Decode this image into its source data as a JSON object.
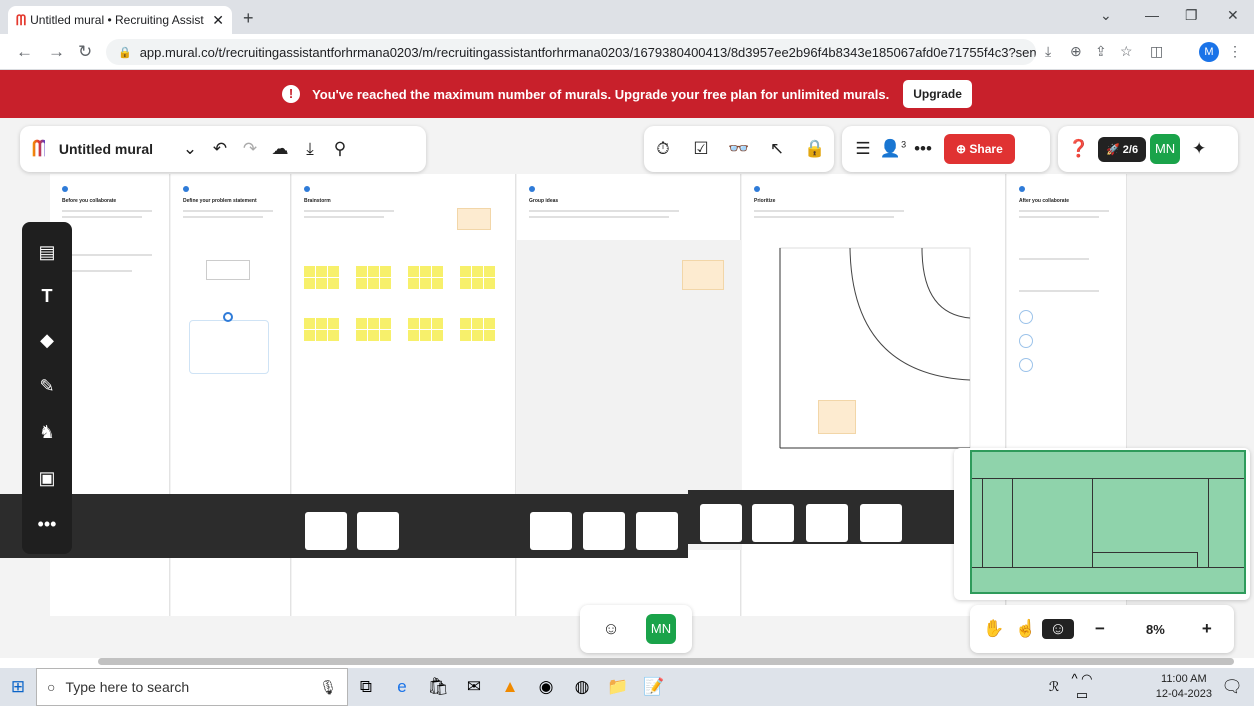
{
  "browser": {
    "tab_title": "Untitled mural • Recruiting Assist",
    "url": "app.mural.co/t/recruitingassistantforhrmana0203/m/recruitingassistantforhrmana0203/1679380400413/8d3957ee2b96f4b8343e185067afd0e71755f4c3?send...",
    "profile_initial": "M"
  },
  "banner": {
    "message": "You've reached the maximum number of murals. Upgrade your free plan for unlimited murals.",
    "upgrade_label": "Upgrade"
  },
  "toolbar": {
    "mural_name": "Untitled mural",
    "share_label": "Share",
    "collaborator_count": "3",
    "outline_progress": "2/6",
    "user_initials": "MN"
  },
  "boards": [
    {
      "title": "Before you collaborate"
    },
    {
      "title": "Define your problem statement"
    },
    {
      "title": "Brainstorm"
    },
    {
      "title": "Group ideas"
    },
    {
      "title": "Prioritize"
    },
    {
      "title": "After you collaborate"
    }
  ],
  "zoom": {
    "level": "8%"
  },
  "taskbar": {
    "search_placeholder": "Type here to search",
    "time": "11:00 AM",
    "date": "12-04-2023"
  }
}
